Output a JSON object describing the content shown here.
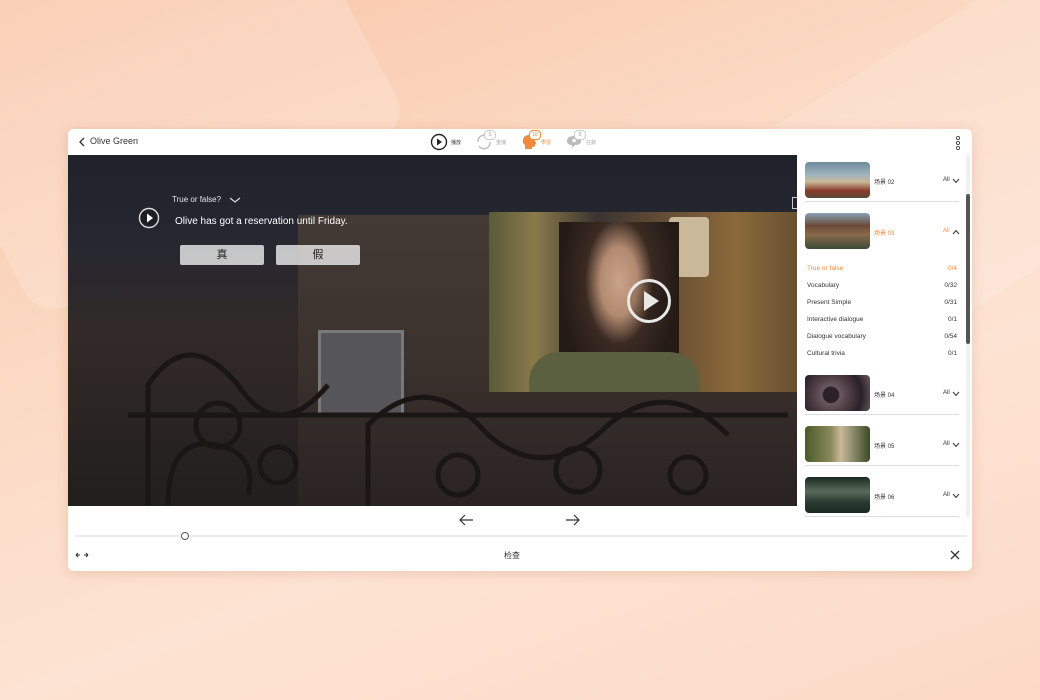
{
  "header": {
    "title": "Olive Green",
    "modes": [
      {
        "label": "播放",
        "badge": ""
      },
      {
        "label": "重播",
        "badge": "0"
      },
      {
        "label": "學習",
        "badge": "18"
      },
      {
        "label": "在錄",
        "badge": "0"
      }
    ]
  },
  "quiz": {
    "type_label": "True or false?",
    "question": "Olive has got a reservation until Friday.",
    "answer_true": "真",
    "answer_false": "假"
  },
  "footer": {
    "check_label": "检查"
  },
  "sidebar": {
    "scenes": [
      {
        "name": "场景 02",
        "filter": "All",
        "thumb_colors": [
          "#6f8a9c",
          "#c9b99a",
          "#8a3a2a"
        ]
      },
      {
        "name": "场景 03",
        "filter": "All",
        "thumb_colors": [
          "#6a4a38",
          "#8a6a4a",
          "#3a4a3a"
        ]
      },
      {
        "name": "场景 04",
        "filter": "All",
        "thumb_colors": [
          "#4a3a40",
          "#2a2228",
          "#6a5a60"
        ]
      },
      {
        "name": "场景 05",
        "filter": "All",
        "thumb_colors": [
          "#4a5a2a",
          "#8a8a5a",
          "#3a4a2a"
        ]
      },
      {
        "name": "场景 06",
        "filter": "All",
        "thumb_colors": [
          "#2a3a30",
          "#5a6a5a",
          "#1a2a22"
        ]
      }
    ],
    "subsections": [
      {
        "label": "True or false",
        "count": "0/4"
      },
      {
        "label": "Vocabulary",
        "count": "0/32"
      },
      {
        "label": "Present Simple",
        "count": "0/31"
      },
      {
        "label": "Interactive dialogue",
        "count": "0/1"
      },
      {
        "label": "Dialogue vocabulary",
        "count": "0/54"
      },
      {
        "label": "Cultural trivia",
        "count": "0/1"
      }
    ]
  },
  "colors": {
    "accent": "#f08a3c",
    "text": "#333333"
  }
}
